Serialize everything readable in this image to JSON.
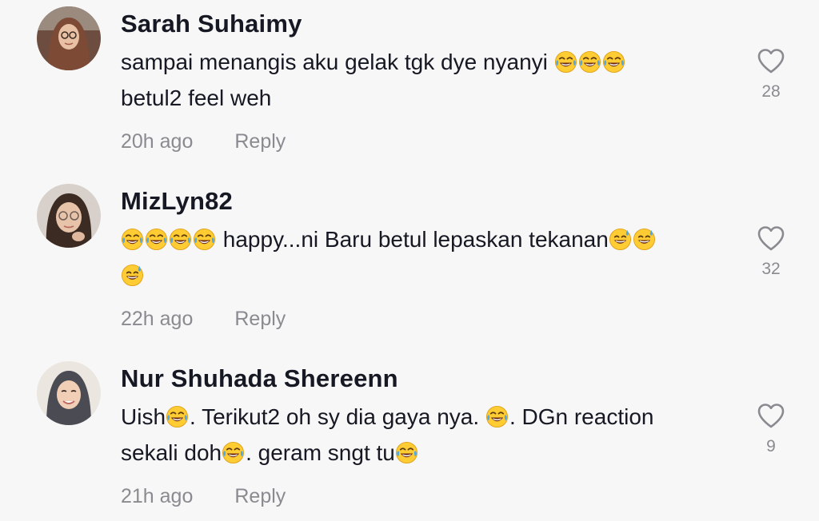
{
  "comments": [
    {
      "username": "Sarah Suhaimy",
      "text_lines": [
        "sampai menangis aku gelak tgk dye nyanyi 😂😂😂",
        "betul2 feel weh"
      ],
      "time": "20h ago",
      "reply_label": "Reply",
      "likes": "28",
      "avatar_colors": {
        "bg": "#6b4a3a",
        "hijab": "#7a4b3a",
        "face": "#e9c2a6"
      }
    },
    {
      "username": "MizLyn82",
      "text_lines": [
        "😂😂😂😂 happy...ni Baru betul lepaskan tekanan😅😅",
        "😅"
      ],
      "time": "22h ago",
      "reply_label": "Reply",
      "likes": "32",
      "avatar_colors": {
        "bg": "#d9d2cc",
        "hair": "#3a2a22",
        "face": "#e6c1a8"
      }
    },
    {
      "username": "Nur Shuhada Shereenn",
      "text_lines": [
        "Uish😂. Terikut2 oh sy dia gaya nya. 😂. DGn reaction",
        "sekali doh😂. geram sngt tu😂"
      ],
      "time": "21h ago",
      "reply_label": "Reply",
      "likes": "9",
      "avatar_colors": {
        "bg": "#efe9e4",
        "hijab": "#4a4a52",
        "face": "#f0cdb4"
      }
    }
  ],
  "icons": {
    "like": "heart-outline-icon",
    "emoji_laugh": "face-with-tears-of-joy",
    "emoji_sweat": "grinning-face-with-sweat"
  },
  "colors": {
    "background": "#f7f7f7",
    "text": "#161823",
    "muted": "#8a8b91"
  }
}
